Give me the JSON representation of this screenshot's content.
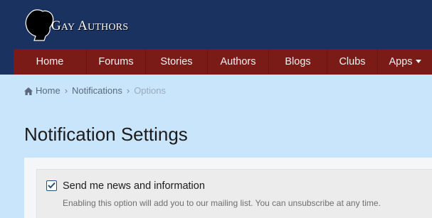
{
  "header": {
    "logo": {
      "text_initial_1": "G",
      "text_rest_1": "AY",
      "text_initial_2": "A",
      "text_rest_2": "UTHORS"
    },
    "nav": {
      "items": [
        {
          "label": "Home"
        },
        {
          "label": "Forums"
        },
        {
          "label": "Stories"
        },
        {
          "label": "Authors"
        },
        {
          "label": "Blogs"
        },
        {
          "label": "Clubs"
        },
        {
          "label": "Apps"
        }
      ]
    }
  },
  "breadcrumb": {
    "items": [
      "Home",
      "Notifications",
      "Options"
    ]
  },
  "page": {
    "title": "Notification Settings"
  },
  "option": {
    "label": "Send me news and information",
    "description": "Enabling this option will add you to our mailing list. You can unsubscribe at any time.",
    "checked": true
  },
  "colors": {
    "header_bg": "#1a3260",
    "nav_bg": "#7a1b17",
    "page_bg": "#c9e5fb"
  }
}
